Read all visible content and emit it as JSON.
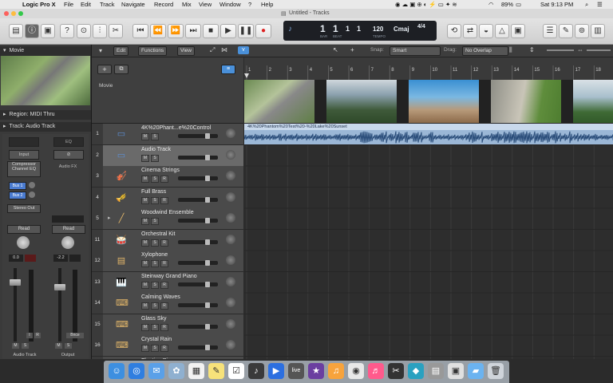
{
  "menubar": {
    "app": "Logic Pro X",
    "items": [
      "File",
      "Edit",
      "Track",
      "Navigate",
      "Record",
      "Mix",
      "View",
      "Window",
      "?",
      "Help"
    ],
    "battery": "89%",
    "clock": "Sat 9:13 PM"
  },
  "window": {
    "title": "Untitled - Tracks"
  },
  "lcd": {
    "bar": "1",
    "beat": "1",
    "div": "1",
    "tick": "1",
    "bpm": "120",
    "key": "Cmaj",
    "sig": "4/4",
    "bar_label": "BAR",
    "beat_label": "BEAT",
    "tempo_label": "TEMPO"
  },
  "inspector": {
    "movie_header": "Movie",
    "region_header": "Region: MIDI Thru",
    "track_header": "Track: Audio Track",
    "input": "Input",
    "eq": "EQ",
    "plugin": "Compressor Channel EQ",
    "audio_fx": "Audio FX",
    "bus1": "Bus 1",
    "bus2": "Bus 2",
    "output": "Stereo Out",
    "read1": "Read",
    "read2": "Read",
    "val1": "0.0",
    "val2": "-2.2",
    "bounce": "Bnce",
    "strip1": "Audio Track",
    "strip2": "Output",
    "m": "M",
    "s": "S",
    "i": "I",
    "r": "R"
  },
  "toolbar": {
    "edit": "Edit",
    "functions": "Functions",
    "view": "View",
    "snap_label": "Snap:",
    "snap_value": "Smart",
    "drag_label": "Drag:",
    "drag_value": "No Overlap",
    "movie_label": "Movie"
  },
  "ruler": [
    "1",
    "2",
    "3",
    "4",
    "5",
    "6",
    "7",
    "8",
    "9",
    "10",
    "11",
    "12",
    "13",
    "14",
    "15",
    "16",
    "17",
    "18"
  ],
  "region": {
    "name": "4K%20Phantom%20Test%20-%20Lake%20Sunset"
  },
  "tracks": [
    {
      "num": "1",
      "name": "4K%20Phant...e%20Control",
      "icon": "▭"
    },
    {
      "num": "2",
      "name": "Audio Track",
      "icon": "▭"
    },
    {
      "num": "3",
      "name": "Cinema Strings",
      "icon": "🎻"
    },
    {
      "num": "4",
      "name": "Full Brass",
      "icon": "🎺"
    },
    {
      "num": "5",
      "name": "Woodwind Ensemble",
      "icon": "╱"
    },
    {
      "num": "11",
      "name": "Orchestral Kit",
      "icon": "🥁"
    },
    {
      "num": "12",
      "name": "Xylophone",
      "icon": "▤"
    },
    {
      "num": "13",
      "name": "Steinway Grand Piano",
      "icon": "🎹"
    },
    {
      "num": "14",
      "name": "Calming Waves",
      "icon": "⌨"
    },
    {
      "num": "15",
      "name": "Glass Sky",
      "icon": "⌨"
    },
    {
      "num": "16",
      "name": "Crystal Rain",
      "icon": "⌨"
    },
    {
      "num": "",
      "name": "Floating Pianos",
      "icon": "⌨"
    }
  ],
  "dock": [
    "finder",
    "safari",
    "mail",
    "photos",
    "calendar",
    "notes",
    "reminders",
    "logic",
    "keynote",
    "live",
    "imovie",
    "garageband",
    "chrome",
    "itunes",
    "final-cut",
    "motion",
    "compressor",
    "preview",
    "folder",
    "trash"
  ]
}
